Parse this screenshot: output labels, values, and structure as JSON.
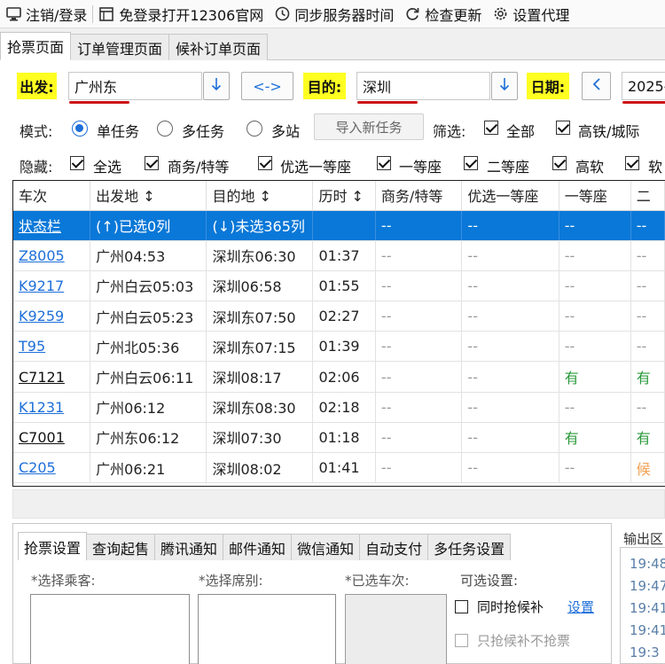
{
  "toolbar": {
    "items": [
      {
        "label": "注销/登录",
        "icon": "monitor-icon"
      },
      {
        "label": "免登录打开12306官网",
        "icon": "browser-window-icon"
      },
      {
        "label": "同步服务器时间",
        "icon": "clock-icon"
      },
      {
        "label": "检查更新",
        "icon": "refresh-icon"
      },
      {
        "label": "设置代理",
        "icon": "gear-icon"
      }
    ]
  },
  "page_tabs": [
    "抢票页面",
    "订单管理页面",
    "候补订单页面"
  ],
  "route": {
    "from_label": "出发:",
    "from_value": "广州东",
    "swap_label": "<->",
    "to_label": "目的:",
    "to_value": "深圳",
    "date_label": "日期:",
    "date_value": "2025-"
  },
  "mode": {
    "label": "模式:",
    "options": [
      "单任务",
      "多任务",
      "多站"
    ],
    "selected": "单任务",
    "import_button": "导入新任务",
    "filter_label": "筛选:",
    "filters": [
      "全部",
      "高铁/城际"
    ]
  },
  "hide": {
    "label": "隐藏:",
    "options": [
      "全选",
      "商务/特等",
      "优选一等座",
      "一等座",
      "二等座",
      "高软",
      "软"
    ]
  },
  "table": {
    "columns": [
      "车次",
      "出发地 ↕",
      "目的地 ↕",
      "历时 ↕",
      "商务/特等",
      "优选一等座",
      "一等座",
      "二"
    ],
    "status_row": [
      "状态栏",
      "(↑)已选0列",
      "(↓)未选365列",
      "",
      "--",
      "--",
      "--",
      "--"
    ],
    "rows": [
      {
        "train": "Z8005",
        "from": "广州04:53",
        "to": "深圳东06:30",
        "dur": "01:37",
        "c1": "--",
        "c2": "--",
        "c3": "--",
        "c4": "--",
        "link": true
      },
      {
        "train": "K9217",
        "from": "广州白云05:03",
        "to": "深圳06:58",
        "dur": "01:55",
        "c1": "--",
        "c2": "--",
        "c3": "--",
        "c4": "--",
        "link": true
      },
      {
        "train": "K9259",
        "from": "广州白云05:23",
        "to": "深圳东07:50",
        "dur": "02:27",
        "c1": "--",
        "c2": "--",
        "c3": "--",
        "c4": "--",
        "link": true
      },
      {
        "train": "T95",
        "from": "广州北05:36",
        "to": "深圳东07:15",
        "dur": "01:39",
        "c1": "--",
        "c2": "--",
        "c3": "--",
        "c4": "--",
        "link": true
      },
      {
        "train": "C7121",
        "from": "广州白云06:11",
        "to": "深圳08:17",
        "dur": "02:06",
        "c1": "--",
        "c2": "--",
        "c3": "有",
        "c4": "有",
        "link": false
      },
      {
        "train": "K1231",
        "from": "广州06:12",
        "to": "深圳东08:30",
        "dur": "02:18",
        "c1": "--",
        "c2": "--",
        "c3": "--",
        "c4": "--",
        "link": true
      },
      {
        "train": "C7001",
        "from": "广州东06:12",
        "to": "深圳07:30",
        "dur": "01:18",
        "c1": "--",
        "c2": "--",
        "c3": "有",
        "c4": "有",
        "link": false
      },
      {
        "train": "C205",
        "from": "广州06:21",
        "to": "深圳08:02",
        "dur": "01:41",
        "c1": "--",
        "c2": "--",
        "c3": "--",
        "c4": "候",
        "link": true
      }
    ]
  },
  "bottom_tabs": [
    "抢票设置",
    "查询起售",
    "腾讯通知",
    "邮件通知",
    "微信通知",
    "自动支付",
    "多任务设置"
  ],
  "settings": {
    "passenger_label": "*选择乘客:",
    "seat_label": "*选择席别:",
    "selected_train_label": "*已选车次:",
    "optional_label": "可选设置:",
    "opt1": "同时抢候补",
    "opt1_link": "设置",
    "opt2": "只抢候补不抢票"
  },
  "output": {
    "title": "输出区",
    "lines": [
      "19:48",
      "19:47",
      "19:41",
      "19:41",
      "19:3"
    ]
  },
  "colors": {
    "accent": "#1e6fd9",
    "selected_row": "#0a78d8",
    "highlight_label": "#ffff22",
    "underline_red": "#cc1111",
    "available_green": "#2a9a3a",
    "waitlist_orange": "#f0a050"
  }
}
